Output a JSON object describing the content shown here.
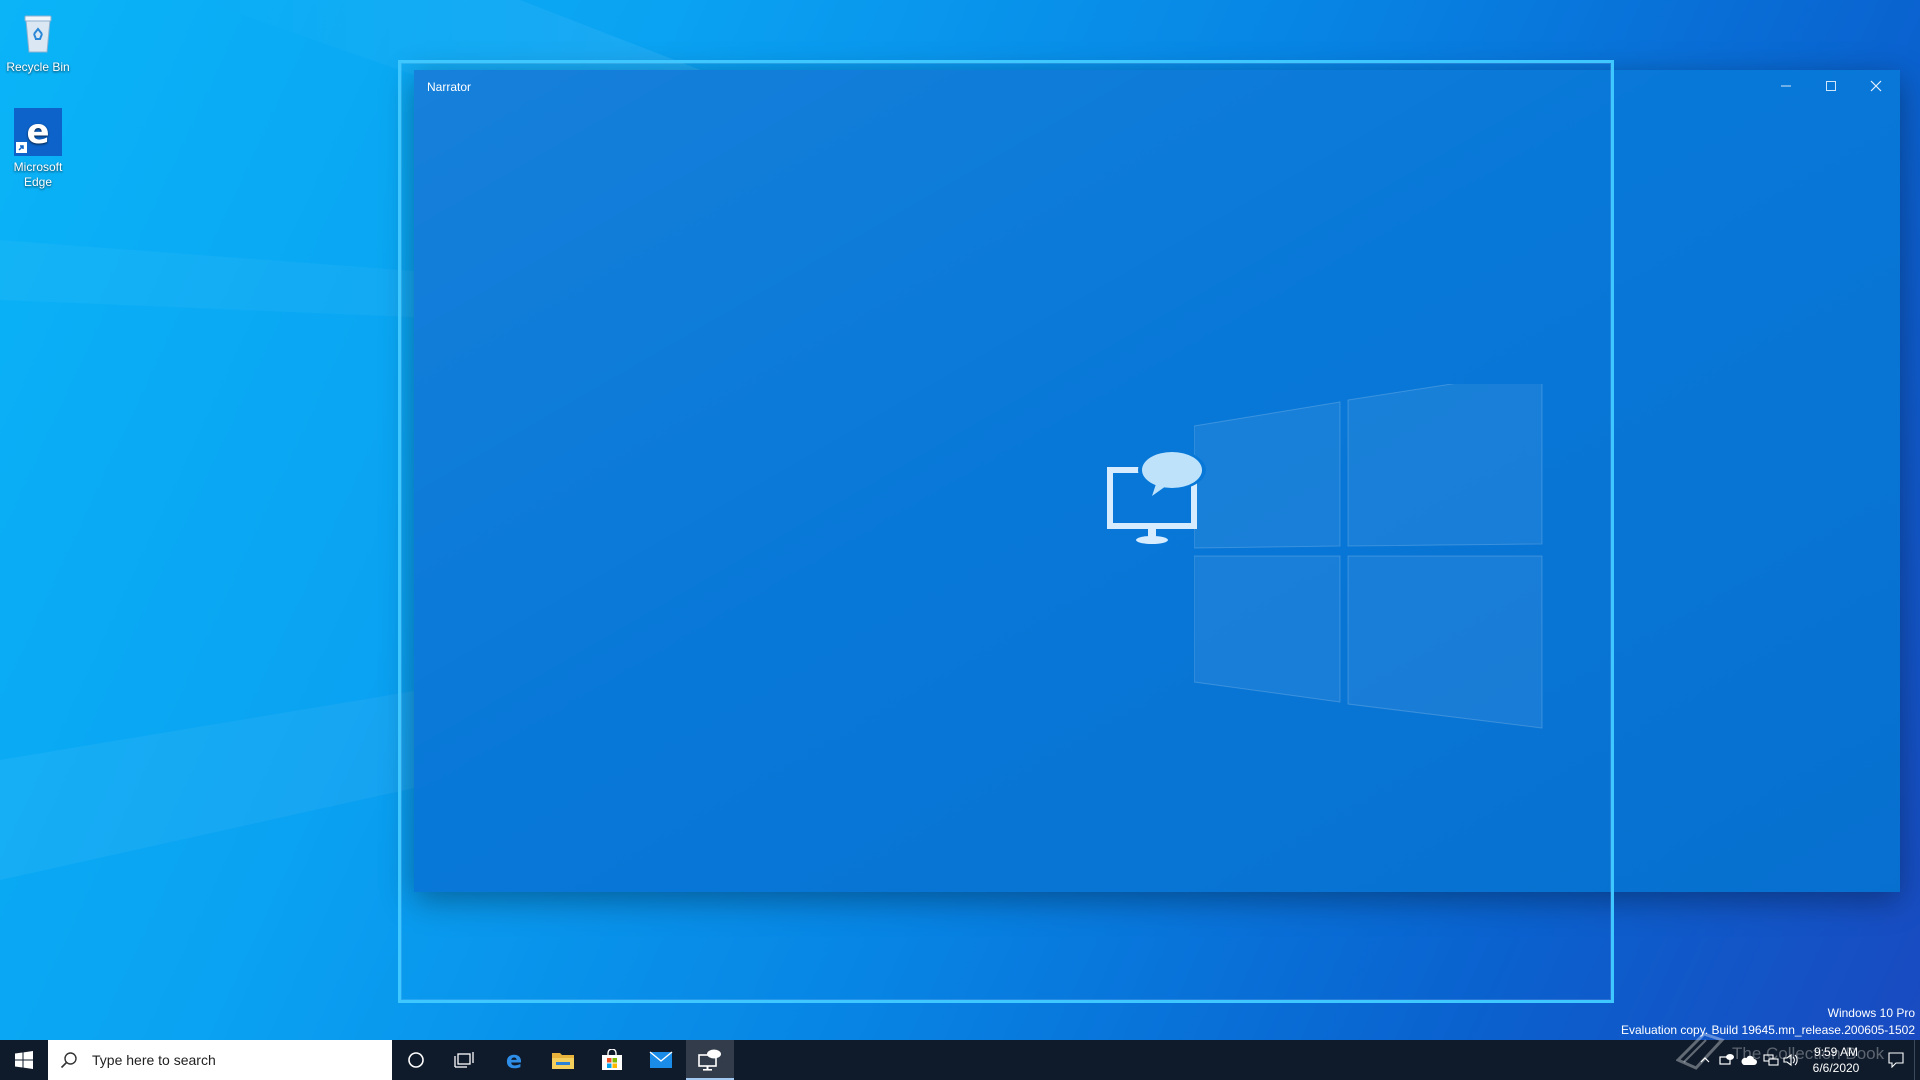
{
  "desktop": {
    "icons": [
      {
        "label": "Recycle Bin",
        "icon": "recycle-bin-icon"
      },
      {
        "label": "Microsoft Edge",
        "icon": "edge-icon"
      }
    ]
  },
  "window": {
    "title": "Narrator",
    "controls": {
      "minimize": "minimize-icon",
      "maximize": "maximize-icon",
      "close": "close-icon"
    },
    "center_icon": "narrator-logo-icon"
  },
  "watermark": {
    "line1": "Windows 10 Pro",
    "line2": "Evaluation copy. Build 19645.mn_release.200605-1502"
  },
  "taskbar": {
    "search_placeholder": "Type here to search",
    "apps": [
      {
        "name": "cortana",
        "icon": "cortana-circle-icon"
      },
      {
        "name": "task-view",
        "icon": "task-view-icon"
      },
      {
        "name": "edge",
        "icon": "edge-icon"
      },
      {
        "name": "file-explorer",
        "icon": "folder-icon"
      },
      {
        "name": "store",
        "icon": "store-icon"
      },
      {
        "name": "mail",
        "icon": "mail-icon"
      },
      {
        "name": "narrator",
        "icon": "narrator-icon",
        "active": true
      }
    ],
    "tray": {
      "time": "9:59 AM",
      "date": "6/6/2020",
      "overlay_text": "The Collection Book"
    }
  },
  "colors": {
    "window_bg": "#0878d8",
    "focus_border": "#3fc7ff",
    "taskbar_bg": "#0f1b2b"
  }
}
